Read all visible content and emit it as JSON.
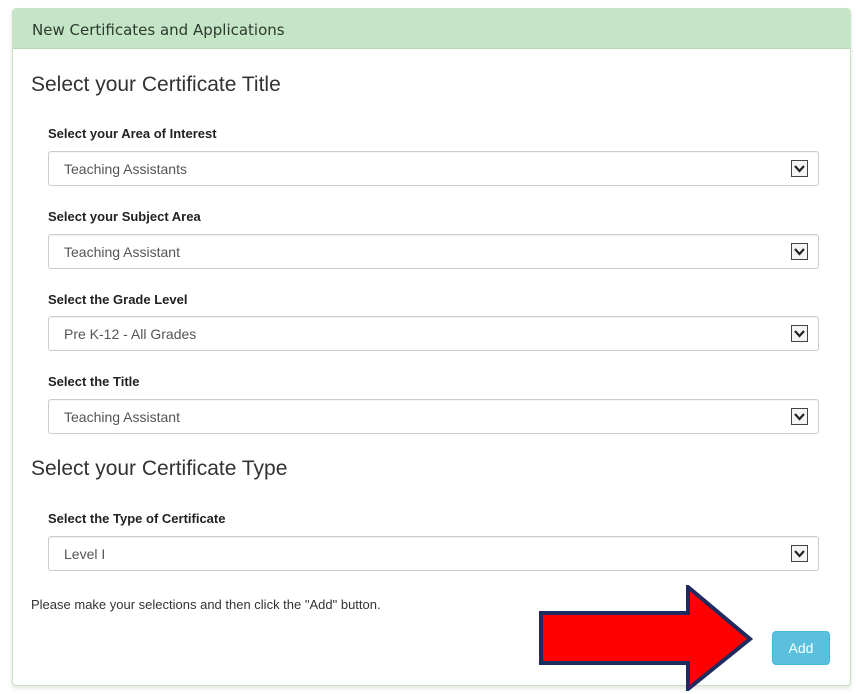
{
  "panel": {
    "heading": "New Certificates and Applications"
  },
  "sections": {
    "title": "Select your Certificate Title",
    "type": "Select your Certificate Type"
  },
  "fields": [
    {
      "label": "Select your Area of Interest",
      "value": "Teaching Assistants"
    },
    {
      "label": "Select your Subject Area",
      "value": "Teaching Assistant"
    },
    {
      "label": "Select the Grade Level",
      "value": "Pre K-12 - All Grades"
    },
    {
      "label": "Select the Title",
      "value": "Teaching Assistant"
    },
    {
      "label": "Select the Type of Certificate",
      "value": "Level I"
    }
  ],
  "helper_text": "Please make your selections and then click the \"Add\" button.",
  "add_button": {
    "label": "Add"
  },
  "colors": {
    "panel_heading_bg": "#c4e6c6",
    "add_button_bg": "#5bc0de",
    "annotation_arrow_fill": "#ff0000",
    "annotation_arrow_stroke": "#1f2b5e"
  },
  "icons": {
    "select_arrow": "chevron-down-icon",
    "annotation": "red-arrow-right-icon"
  }
}
